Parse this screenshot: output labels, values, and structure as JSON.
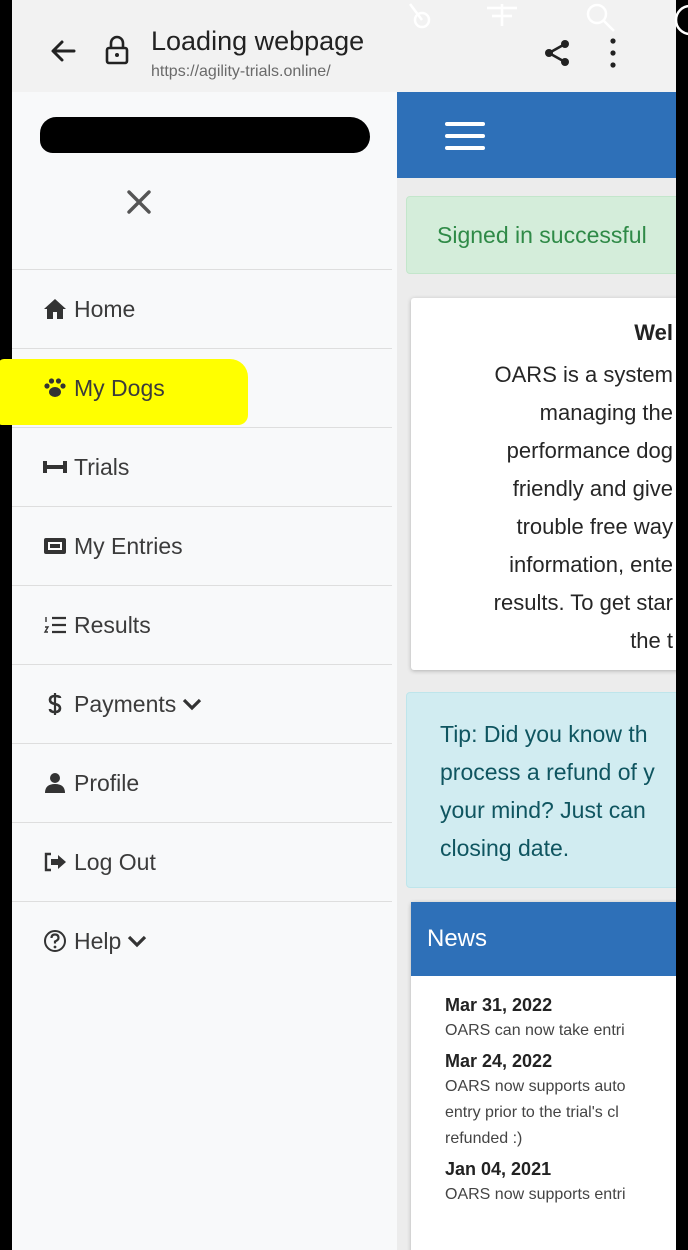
{
  "browser": {
    "title": "Loading webpage",
    "url": "https://agility-trials.online/"
  },
  "drawer": {
    "items": [
      {
        "label": "Home",
        "icon": "home-icon"
      },
      {
        "label": "My Dogs",
        "icon": "paw-icon",
        "highlighted": true
      },
      {
        "label": "Trials",
        "icon": "bone-icon"
      },
      {
        "label": "My Entries",
        "icon": "ticket-icon"
      },
      {
        "label": "Results",
        "icon": "list-ol-icon"
      },
      {
        "label": "Payments",
        "icon": "dollar-icon",
        "has_dropdown": true
      },
      {
        "label": "Profile",
        "icon": "user-icon"
      },
      {
        "label": "Log Out",
        "icon": "sign-out-icon"
      },
      {
        "label": "Help",
        "icon": "question-circle-icon",
        "has_dropdown": true
      }
    ]
  },
  "main": {
    "success_alert": "Signed in successful",
    "welcome": {
      "title": "Wel",
      "lines": [
        "OARS is a system",
        "managing the",
        "performance dog",
        "friendly and give",
        "trouble free way",
        "information, ente",
        "results. To get star",
        "the t"
      ]
    },
    "tip_lines": [
      "Tip: Did you know th",
      "process a refund of y",
      "your mind? Just can",
      "closing date."
    ],
    "news": {
      "header": "News",
      "items": [
        {
          "date": "Mar 31, 2022",
          "lines": [
            "OARS can now take entri"
          ]
        },
        {
          "date": "Mar 24, 2022",
          "lines": [
            "OARS now supports auto",
            "entry prior to the trial's cl",
            "refunded :)"
          ]
        },
        {
          "date": "Jan 04, 2021",
          "lines": [
            "OARS now supports entri"
          ]
        }
      ]
    }
  },
  "colors": {
    "nav_blue": "#2e70b8",
    "highlight": "#ffff00",
    "success_bg": "#d4edda",
    "info_bg": "#d1ecf1"
  }
}
